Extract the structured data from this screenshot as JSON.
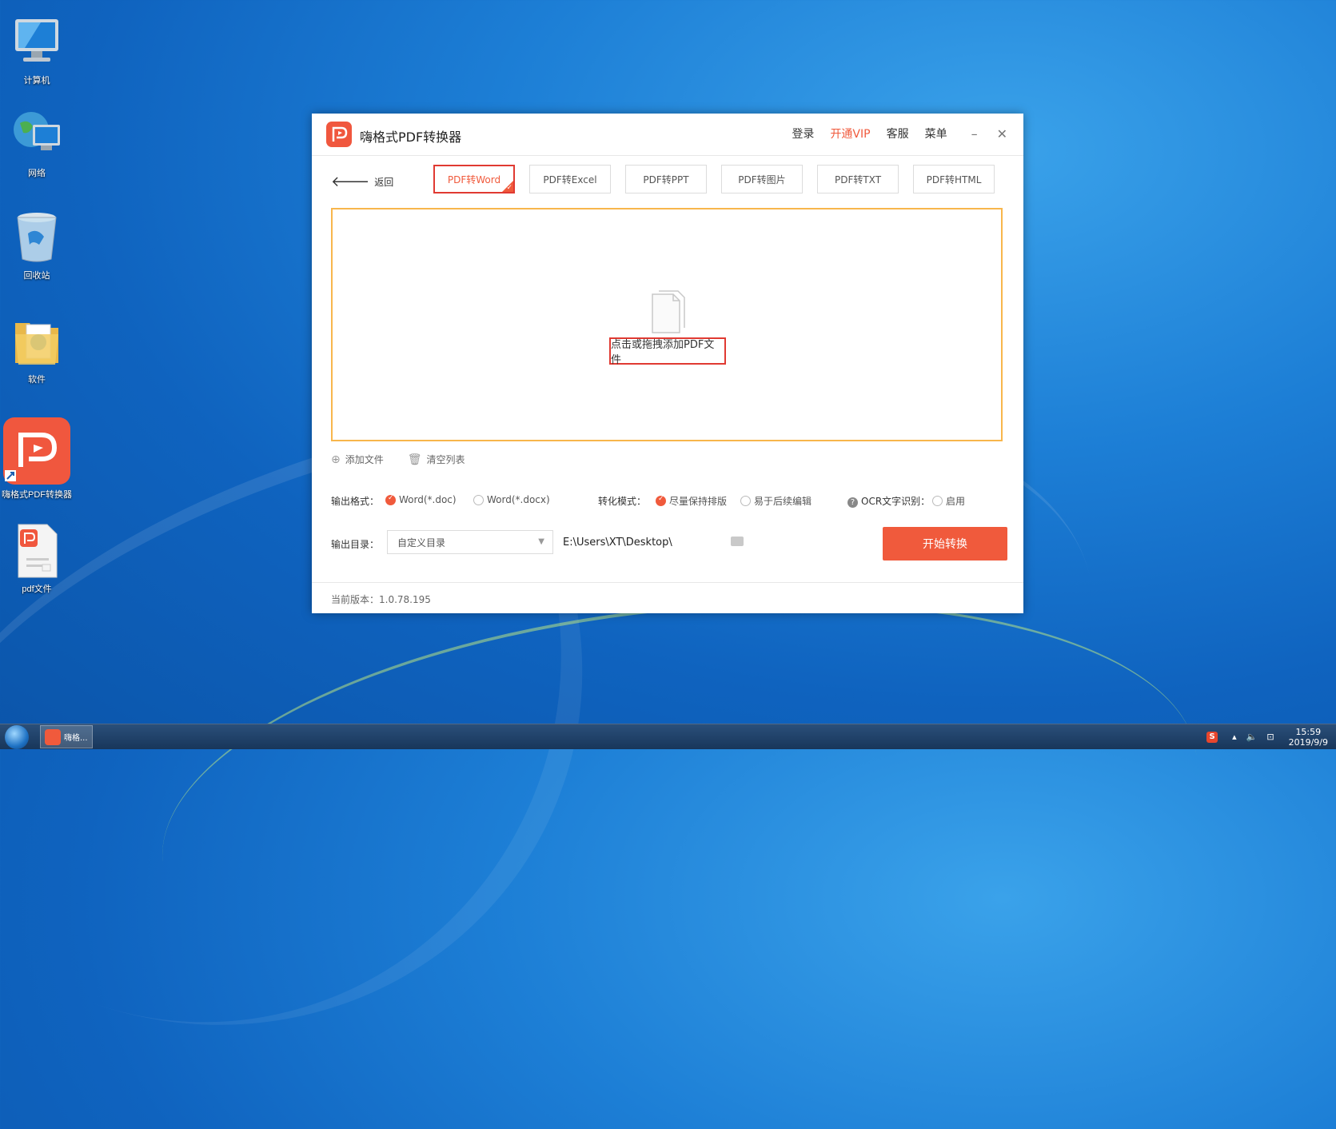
{
  "desktop": {
    "icons": [
      {
        "label": "计算机",
        "icon": "computer-icon"
      },
      {
        "label": "网络",
        "icon": "network-icon"
      },
      {
        "label": "回收站",
        "icon": "recycle-bin-icon"
      },
      {
        "label": "软件",
        "icon": "folder-icon"
      },
      {
        "label": "嗨格式PDF转换器",
        "icon": "pdf-converter-icon"
      },
      {
        "label": "pdf文件",
        "icon": "pdf-file-icon"
      }
    ]
  },
  "window": {
    "title": "嗨格式PDF转换器",
    "header_links": {
      "login": "登录",
      "vip": "开通VIP",
      "service": "客服",
      "menu": "菜单"
    },
    "controls": {
      "minimize": "–",
      "close": "✕"
    },
    "back_label": "返回",
    "tabs": [
      {
        "label": "PDF转Word",
        "active": true
      },
      {
        "label": "PDF转Excel"
      },
      {
        "label": "PDF转PPT"
      },
      {
        "label": "PDF转图片"
      },
      {
        "label": "PDF转TXT"
      },
      {
        "label": "PDF转HTML"
      }
    ],
    "dropzone_text": "点击或拖拽添加PDF文件",
    "actions": {
      "add_file": "添加文件",
      "clear_list": "清空列表"
    },
    "output_format": {
      "label": "输出格式：",
      "options": [
        {
          "label": "Word(*.doc)",
          "selected": true
        },
        {
          "label": "Word(*.docx)",
          "selected": false
        }
      ]
    },
    "convert_mode": {
      "label": "转化模式：",
      "options": [
        {
          "label": "尽量保持排版",
          "selected": true
        },
        {
          "label": "易于后续编辑",
          "selected": false
        }
      ]
    },
    "ocr": {
      "label": "OCR文字识别：",
      "option": "启用",
      "help": "?"
    },
    "output_dir": {
      "label": "输出目录：",
      "select_value": "自定义目录",
      "path": "E:\\Users\\XT\\Desktop\\"
    },
    "start_button": "开始转换",
    "version": "当前版本：1.0.78.195"
  },
  "taskbar": {
    "app_label": "嗨格...",
    "time": "15:59",
    "date": "2019/9/9"
  },
  "colors": {
    "accent": "#f05a3c",
    "highlight_border": "#e03a32",
    "dropzone_border": "#f8b64c"
  }
}
